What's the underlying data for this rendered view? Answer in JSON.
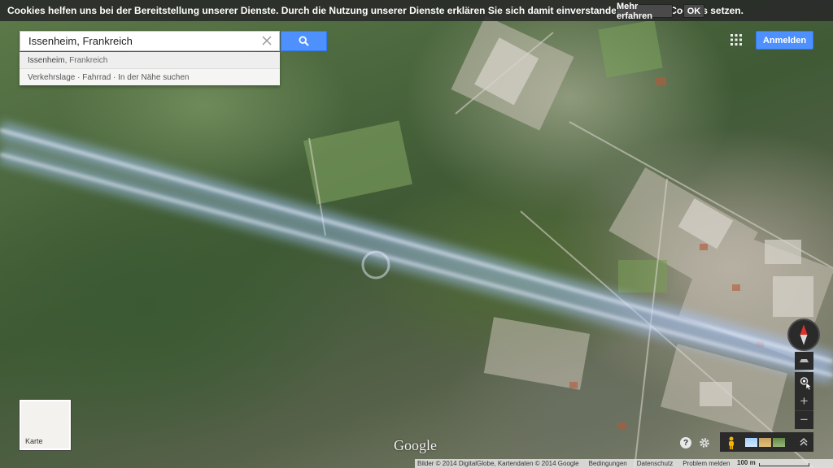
{
  "cookie_bar": {
    "text": "Cookies helfen uns bei der Bereitstellung unserer Dienste. Durch die Nutzung unserer Dienste erklären Sie sich damit einverstanden, dass wir Cookies setzen.",
    "more_label": "Mehr erfahren",
    "ok_label": "OK"
  },
  "search": {
    "value": "Issenheim, Frankreich",
    "suggestion_bold": "Issenheim",
    "suggestion_rest": ", Frankreich",
    "actions": "Verkehrslage · Fahrrad · In der Nähe suchen"
  },
  "header": {
    "signin_label": "Anmelden"
  },
  "map_type": {
    "label": "Karte"
  },
  "logo": {
    "text": "Google"
  },
  "controls": {
    "zoom_in": "+",
    "zoom_out": "−",
    "help": "?"
  },
  "footer": {
    "imagery": "Bilder © 2014 DigitalGlobe, Kartendaten © 2014 Google",
    "terms": "Bedingungen",
    "privacy": "Datenschutz",
    "report": "Problem melden",
    "scale": "100 m"
  },
  "colors": {
    "accent_blue": "#4d90fe",
    "control_bg": "#2a2a2a"
  },
  "icons": [
    "search-icon",
    "clear-icon",
    "apps-grid-icon",
    "compass-icon",
    "tilt-icon",
    "my-location-icon",
    "help-icon",
    "settings-icon",
    "pegman-icon",
    "expand-icon"
  ]
}
